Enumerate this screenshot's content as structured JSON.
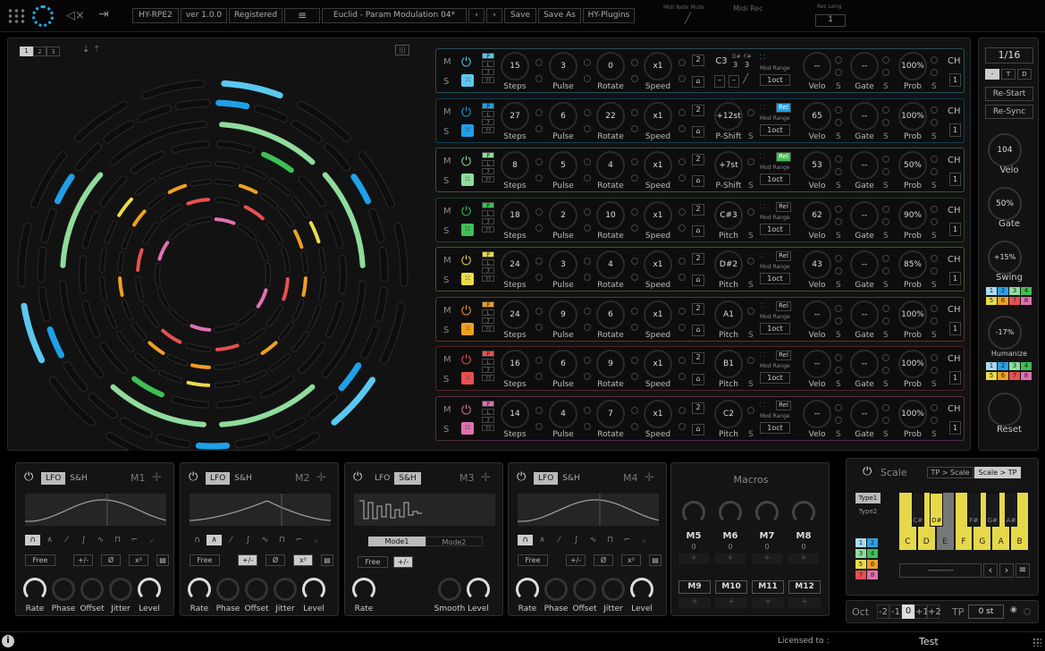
{
  "topbar": {
    "product": "HY-RPE2",
    "version": "ver 1.0.0",
    "registration": "Registered",
    "preset_name": "Euclid - Param Modulation 04*",
    "save": "Save",
    "save_as": "Save As",
    "plugins": "HY-Plugins",
    "midi_note_mute": "Midi Note Mute",
    "midi_rec": "Midi Rec",
    "rec_length_label": "Rec Leng",
    "rec_length_value": "1"
  },
  "circle": {
    "pages": [
      "1",
      "2",
      "3"
    ],
    "active_page": "1"
  },
  "rows": [
    {
      "color": "#5bc8f0",
      "steps": "15",
      "pulse": "3",
      "rotate": "0",
      "speed": "x1",
      "oct": "2",
      "pitch_mode": "note",
      "note": "C3",
      "note2": "D#",
      "note2v": "3",
      "note3": "F#",
      "note3v": "3",
      "pitch_label": "",
      "rel": false,
      "mod_range": "1oct",
      "velo": "--",
      "gate": "--",
      "prob": "100%",
      "ch": "1"
    },
    {
      "color": "#1fa0e8",
      "steps": "27",
      "pulse": "6",
      "rotate": "22",
      "speed": "x1",
      "oct": "2",
      "pitch_mode": "knob",
      "pitch_value": "+12st",
      "pitch_label": "P-Shift",
      "rel": true,
      "mod_range": "1oct",
      "velo": "65",
      "gate": "--",
      "prob": "100%",
      "ch": "1"
    },
    {
      "color": "#8fdc9c",
      "steps": "8",
      "pulse": "5",
      "rotate": "4",
      "speed": "x1",
      "oct": "2",
      "pitch_mode": "knob",
      "pitch_value": "+7st",
      "pitch_label": "P-Shift",
      "rel": true,
      "mod_range": "1oct",
      "velo": "53",
      "gate": "--",
      "prob": "50%",
      "ch": "1"
    },
    {
      "color": "#3fbf55",
      "steps": "18",
      "pulse": "2",
      "rotate": "10",
      "speed": "x1",
      "oct": "2",
      "pitch_mode": "knob",
      "pitch_value": "C#3",
      "pitch_label": "Pitch",
      "rel": false,
      "mod_range": "1oct",
      "velo": "62",
      "gate": "--",
      "prob": "90%",
      "ch": "1"
    },
    {
      "color": "#e8dc4a",
      "steps": "24",
      "pulse": "3",
      "rotate": "4",
      "speed": "x1",
      "oct": "2",
      "pitch_mode": "knob",
      "pitch_value": "D#2",
      "pitch_label": "Pitch",
      "rel": false,
      "mod_range": "1oct",
      "velo": "43",
      "gate": "--",
      "prob": "85%",
      "ch": "1"
    },
    {
      "color": "#f0a020",
      "steps": "24",
      "pulse": "9",
      "rotate": "6",
      "speed": "x1",
      "oct": "2",
      "pitch_mode": "knob",
      "pitch_value": "A1",
      "pitch_label": "Pitch",
      "rel": false,
      "mod_range": "1oct",
      "velo": "--",
      "gate": "--",
      "prob": "100%",
      "ch": "1"
    },
    {
      "color": "#e85050",
      "steps": "16",
      "pulse": "6",
      "rotate": "9",
      "speed": "x1",
      "oct": "2",
      "pitch_mode": "knob",
      "pitch_value": "B1",
      "pitch_label": "Pitch",
      "rel": false,
      "mod_range": "1oct",
      "velo": "--",
      "gate": "--",
      "prob": "100%",
      "ch": "1"
    },
    {
      "color": "#e070b0",
      "steps": "14",
      "pulse": "4",
      "rotate": "7",
      "speed": "x1",
      "oct": "2",
      "pitch_mode": "knob",
      "pitch_value": "C2",
      "pitch_label": "Pitch",
      "rel": false,
      "mod_range": "1oct",
      "velo": "--",
      "gate": "--",
      "prob": "100%",
      "ch": "1"
    }
  ],
  "labels": {
    "m": "M",
    "s": "S",
    "steps": "Steps",
    "pulse": "Pulse",
    "rotate": "Rotate",
    "speed": "Speed",
    "velo": "Velo",
    "gate": "Gate",
    "prob": "Prob",
    "ch": "CH",
    "rel": "Rel",
    "mod_range": "Mod Range",
    "s_small": "S",
    "pg": [
      "P",
      "L",
      "7",
      "??"
    ]
  },
  "right": {
    "division": "1/16",
    "mode_buttons": [
      "-",
      "T",
      "D"
    ],
    "restart": "Re-Start",
    "resync": "Re-Sync",
    "velo_value": "104",
    "velo_label": "Velo",
    "gate_value": "50%",
    "gate_label": "Gate",
    "swing_value": "+15%",
    "swing_label": "Swing",
    "humanize_value": "-17%",
    "humanize_label": "Humanize",
    "reset_label": "Reset",
    "grid": [
      "1",
      "2",
      "3",
      "4",
      "5",
      "6",
      "7",
      "8"
    ]
  },
  "modulators": [
    {
      "name": "M1",
      "mode": "LFO",
      "shape_index": 0,
      "sync": "Free",
      "bipolar": false,
      "invert": false,
      "square": false,
      "knobs": [
        "Rate",
        "Phase",
        "Offset",
        "Jitter",
        "Level"
      ]
    },
    {
      "name": "M2",
      "mode": "LFO",
      "shape_index": 1,
      "sync": "Free",
      "bipolar": true,
      "invert": false,
      "square": true,
      "knobs": [
        "Rate",
        "Phase",
        "Offset",
        "Jitter",
        "Level"
      ]
    },
    {
      "name": "M3",
      "mode": "S&H",
      "sh_modes": [
        "Mode1",
        "Mode2"
      ],
      "sh_active": "Mode1",
      "sync": "Free",
      "bipolar": true,
      "knobs": [
        "Rate",
        "Smooth",
        "Level"
      ]
    },
    {
      "name": "M4",
      "mode": "LFO",
      "shape_index": 0,
      "sync": "Free",
      "bipolar": false,
      "invert": false,
      "square": false,
      "knobs": [
        "Rate",
        "Phase",
        "Offset",
        "Jitter",
        "Level"
      ]
    }
  ],
  "mod_common": {
    "lfo": "LFO",
    "sh": "S&H",
    "bipolar": "+/-",
    "invert": "Ø",
    "square": "x²",
    "shapes": [
      "∩",
      "∧",
      "⁄",
      "∫",
      "∿",
      "⊓",
      "⌐",
      "⸝"
    ]
  },
  "macros": {
    "title": "Macros",
    "knobs": [
      {
        "name": "M5",
        "value": "0"
      },
      {
        "name": "M6",
        "value": "0"
      },
      {
        "name": "M7",
        "value": "0"
      },
      {
        "name": "M8",
        "value": "0"
      }
    ],
    "buttons": [
      "M9",
      "M10",
      "M11",
      "M12"
    ]
  },
  "scale": {
    "title": "Scale",
    "tp_to_scale": "TP > Scale",
    "scale_to_tp": "Scale > TP",
    "type1": "Type1",
    "type2": "Type2",
    "white_keys": [
      {
        "n": "C",
        "on": true
      },
      {
        "n": "D",
        "on": true
      },
      {
        "n": "E",
        "on": false
      },
      {
        "n": "F",
        "on": true
      },
      {
        "n": "G",
        "on": true
      },
      {
        "n": "A",
        "on": true
      },
      {
        "n": "B",
        "on": true
      }
    ],
    "black_keys": [
      {
        "n": "C#",
        "on": false
      },
      {
        "n": "D#",
        "on": true
      },
      {
        "n": "F#",
        "on": false
      },
      {
        "n": "G#",
        "on": false
      },
      {
        "n": "A#",
        "on": false
      }
    ],
    "scale_name": "---------",
    "grid": [
      "1",
      "2",
      "3",
      "4",
      "5",
      "6",
      "7",
      "8"
    ]
  },
  "octave": {
    "label": "Oct",
    "values": [
      "-2",
      "-1",
      "0",
      "+1",
      "+2"
    ],
    "active": "0",
    "tp_label": "TP",
    "tp_value": "0 st"
  },
  "footer": {
    "licensed_to": "Licensed to :",
    "user": "Test"
  }
}
